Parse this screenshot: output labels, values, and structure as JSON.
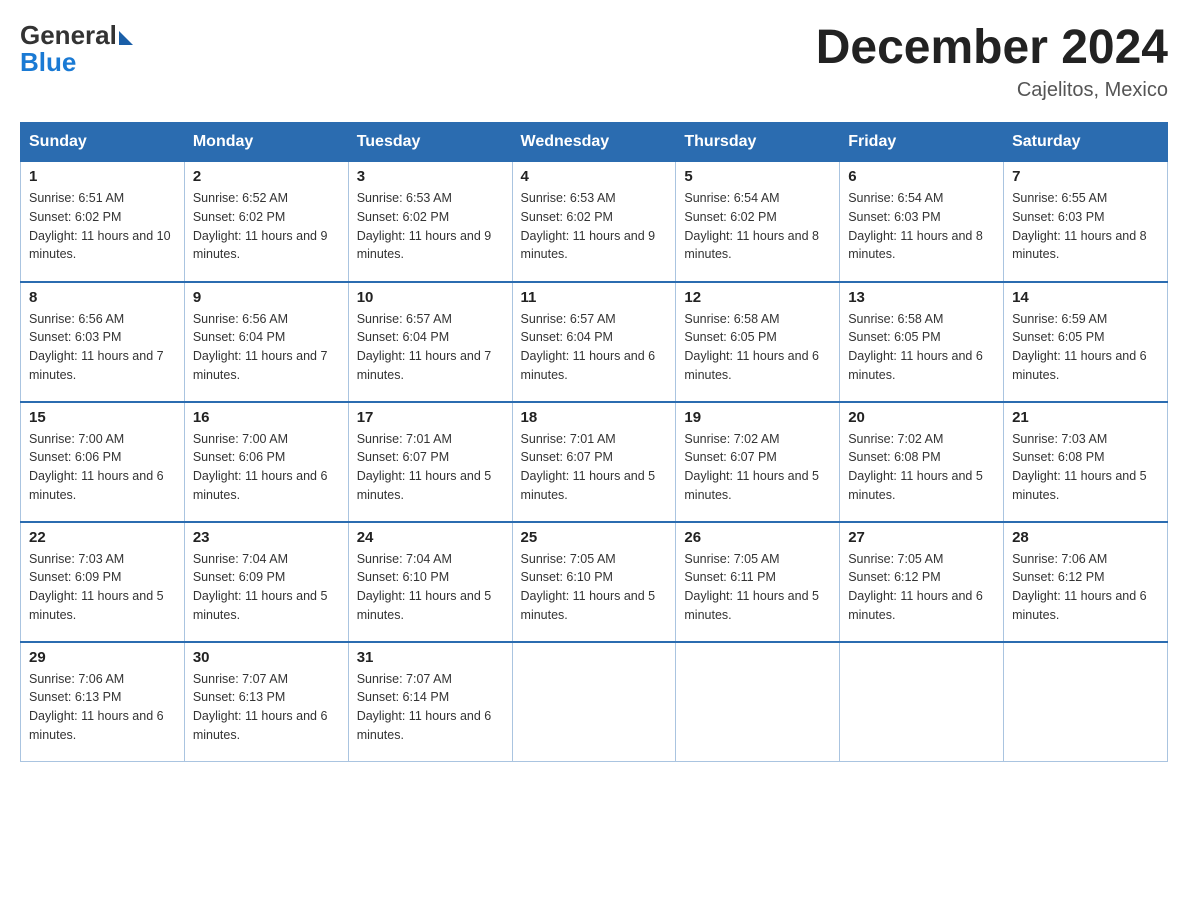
{
  "header": {
    "logo": {
      "general": "General",
      "blue": "Blue"
    },
    "title": "December 2024",
    "location": "Cajelitos, Mexico"
  },
  "weekdays": [
    "Sunday",
    "Monday",
    "Tuesday",
    "Wednesday",
    "Thursday",
    "Friday",
    "Saturday"
  ],
  "weeks": [
    [
      {
        "day": "1",
        "sunrise": "6:51 AM",
        "sunset": "6:02 PM",
        "daylight": "11 hours and 10 minutes."
      },
      {
        "day": "2",
        "sunrise": "6:52 AM",
        "sunset": "6:02 PM",
        "daylight": "11 hours and 9 minutes."
      },
      {
        "day": "3",
        "sunrise": "6:53 AM",
        "sunset": "6:02 PM",
        "daylight": "11 hours and 9 minutes."
      },
      {
        "day": "4",
        "sunrise": "6:53 AM",
        "sunset": "6:02 PM",
        "daylight": "11 hours and 9 minutes."
      },
      {
        "day": "5",
        "sunrise": "6:54 AM",
        "sunset": "6:02 PM",
        "daylight": "11 hours and 8 minutes."
      },
      {
        "day": "6",
        "sunrise": "6:54 AM",
        "sunset": "6:03 PM",
        "daylight": "11 hours and 8 minutes."
      },
      {
        "day": "7",
        "sunrise": "6:55 AM",
        "sunset": "6:03 PM",
        "daylight": "11 hours and 8 minutes."
      }
    ],
    [
      {
        "day": "8",
        "sunrise": "6:56 AM",
        "sunset": "6:03 PM",
        "daylight": "11 hours and 7 minutes."
      },
      {
        "day": "9",
        "sunrise": "6:56 AM",
        "sunset": "6:04 PM",
        "daylight": "11 hours and 7 minutes."
      },
      {
        "day": "10",
        "sunrise": "6:57 AM",
        "sunset": "6:04 PM",
        "daylight": "11 hours and 7 minutes."
      },
      {
        "day": "11",
        "sunrise": "6:57 AM",
        "sunset": "6:04 PM",
        "daylight": "11 hours and 6 minutes."
      },
      {
        "day": "12",
        "sunrise": "6:58 AM",
        "sunset": "6:05 PM",
        "daylight": "11 hours and 6 minutes."
      },
      {
        "day": "13",
        "sunrise": "6:58 AM",
        "sunset": "6:05 PM",
        "daylight": "11 hours and 6 minutes."
      },
      {
        "day": "14",
        "sunrise": "6:59 AM",
        "sunset": "6:05 PM",
        "daylight": "11 hours and 6 minutes."
      }
    ],
    [
      {
        "day": "15",
        "sunrise": "7:00 AM",
        "sunset": "6:06 PM",
        "daylight": "11 hours and 6 minutes."
      },
      {
        "day": "16",
        "sunrise": "7:00 AM",
        "sunset": "6:06 PM",
        "daylight": "11 hours and 6 minutes."
      },
      {
        "day": "17",
        "sunrise": "7:01 AM",
        "sunset": "6:07 PM",
        "daylight": "11 hours and 5 minutes."
      },
      {
        "day": "18",
        "sunrise": "7:01 AM",
        "sunset": "6:07 PM",
        "daylight": "11 hours and 5 minutes."
      },
      {
        "day": "19",
        "sunrise": "7:02 AM",
        "sunset": "6:07 PM",
        "daylight": "11 hours and 5 minutes."
      },
      {
        "day": "20",
        "sunrise": "7:02 AM",
        "sunset": "6:08 PM",
        "daylight": "11 hours and 5 minutes."
      },
      {
        "day": "21",
        "sunrise": "7:03 AM",
        "sunset": "6:08 PM",
        "daylight": "11 hours and 5 minutes."
      }
    ],
    [
      {
        "day": "22",
        "sunrise": "7:03 AM",
        "sunset": "6:09 PM",
        "daylight": "11 hours and 5 minutes."
      },
      {
        "day": "23",
        "sunrise": "7:04 AM",
        "sunset": "6:09 PM",
        "daylight": "11 hours and 5 minutes."
      },
      {
        "day": "24",
        "sunrise": "7:04 AM",
        "sunset": "6:10 PM",
        "daylight": "11 hours and 5 minutes."
      },
      {
        "day": "25",
        "sunrise": "7:05 AM",
        "sunset": "6:10 PM",
        "daylight": "11 hours and 5 minutes."
      },
      {
        "day": "26",
        "sunrise": "7:05 AM",
        "sunset": "6:11 PM",
        "daylight": "11 hours and 5 minutes."
      },
      {
        "day": "27",
        "sunrise": "7:05 AM",
        "sunset": "6:12 PM",
        "daylight": "11 hours and 6 minutes."
      },
      {
        "day": "28",
        "sunrise": "7:06 AM",
        "sunset": "6:12 PM",
        "daylight": "11 hours and 6 minutes."
      }
    ],
    [
      {
        "day": "29",
        "sunrise": "7:06 AM",
        "sunset": "6:13 PM",
        "daylight": "11 hours and 6 minutes."
      },
      {
        "day": "30",
        "sunrise": "7:07 AM",
        "sunset": "6:13 PM",
        "daylight": "11 hours and 6 minutes."
      },
      {
        "day": "31",
        "sunrise": "7:07 AM",
        "sunset": "6:14 PM",
        "daylight": "11 hours and 6 minutes."
      },
      null,
      null,
      null,
      null
    ]
  ]
}
